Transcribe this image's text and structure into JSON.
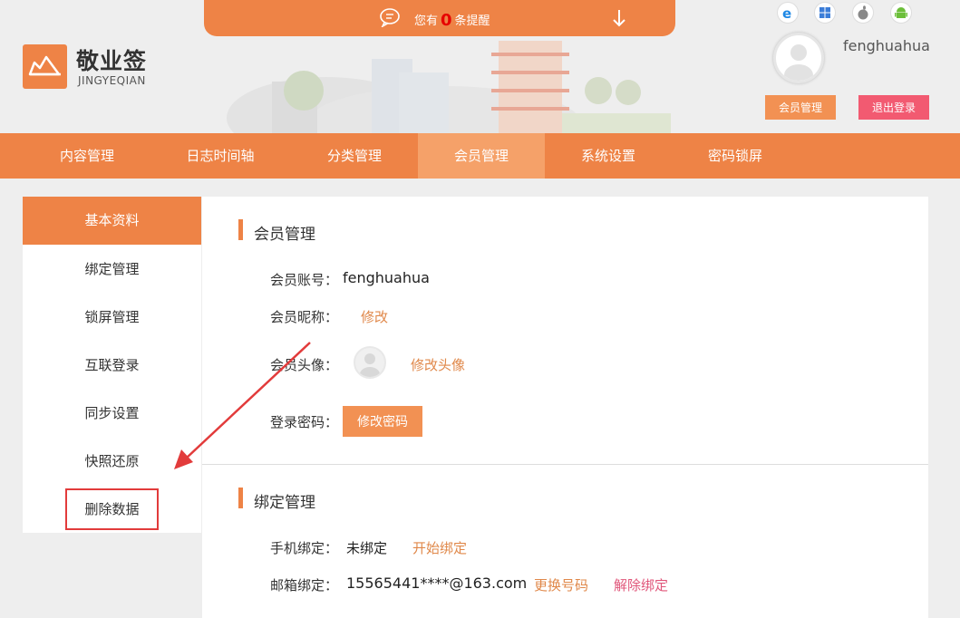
{
  "notice": {
    "prefix": "您有",
    "count": "0",
    "suffix": "条提醒"
  },
  "brand": {
    "name": "敬业签",
    "sub": "JINGYEQIAN"
  },
  "platforms": [
    "ie-icon",
    "windows-icon",
    "apple-icon",
    "android-icon"
  ],
  "user": {
    "name": "fenghuahua",
    "member_btn": "会员管理",
    "logout_btn": "退出登录"
  },
  "nav": {
    "items": [
      "内容管理",
      "日志时间轴",
      "分类管理",
      "会员管理",
      "系统设置",
      "密码锁屏"
    ],
    "active": "会员管理"
  },
  "sidebar": {
    "items": [
      "基本资料",
      "绑定管理",
      "锁屏管理",
      "互联登录",
      "同步设置",
      "快照还原",
      "删除数据"
    ],
    "active": "基本资料",
    "highlighted": "删除数据"
  },
  "member": {
    "title": "会员管理",
    "account_label": "会员账号：",
    "account_value": "fenghuahua",
    "nickname_label": "会员昵称：",
    "nickname_link": "修改",
    "avatar_label": "会员头像：",
    "avatar_link": "修改头像",
    "password_label": "登录密码：",
    "password_btn": "修改密码"
  },
  "binding": {
    "title": "绑定管理",
    "phone_label": "手机绑定：",
    "phone_value": "未绑定",
    "phone_link": "开始绑定",
    "email_label": "邮箱绑定：",
    "email_value": "15565441****@163.com",
    "email_change": "更换号码",
    "email_unbind": "解除绑定"
  },
  "colors": {
    "accent": "#ee8346",
    "nav_active": "#f5a169",
    "logout": "#f25a71",
    "link": "#e0884a",
    "annotation": "#e23b3b"
  }
}
